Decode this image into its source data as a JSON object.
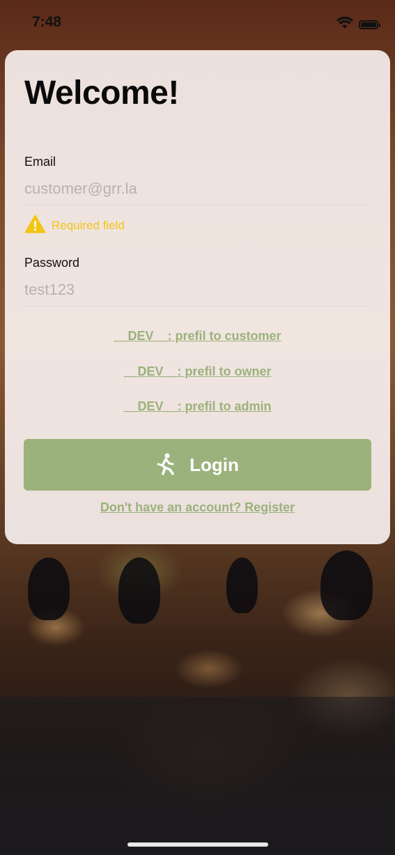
{
  "status_bar": {
    "time": "7:48"
  },
  "login": {
    "title": "Welcome!",
    "email": {
      "label": "Email",
      "placeholder": "customer@grr.la",
      "value": ""
    },
    "email_error": "Required field",
    "password": {
      "label": "Password",
      "placeholder": "test123",
      "value": ""
    },
    "dev_links": [
      "__DEV__: prefil to customer",
      "__DEV__: prefil to owner",
      "__DEV__: prefil to admin"
    ],
    "login_button": "Login",
    "register_link": "Don't have an account? Register"
  },
  "colors": {
    "accent": "#9bb27c",
    "warning": "#f2c516",
    "card_background": "#fff8f8"
  },
  "icons": {
    "warning": "warning-triangle-icon",
    "login": "person-running-icon",
    "wifi": "wifi-icon",
    "battery": "battery-icon"
  }
}
